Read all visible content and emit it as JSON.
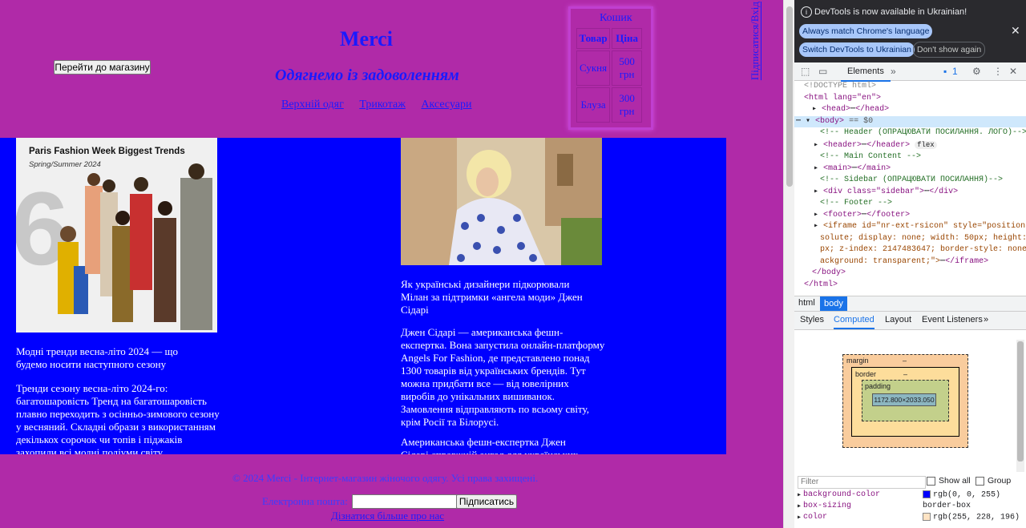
{
  "header": {
    "shop_button": "Перейти до магазину",
    "logo": "Merci",
    "tagline": "Одягнемо із задоволенням",
    "nav": [
      "Верхній одяг",
      "Трикотаж",
      "Аксесуари"
    ],
    "vertical_links": "Підписатися/Вхід"
  },
  "cart": {
    "title": "Кошик",
    "headers": [
      "Товар",
      "Ціна"
    ],
    "rows": [
      {
        "item": "Сукня",
        "price": "500 грн"
      },
      {
        "item": "Блуза",
        "price": "300 грн"
      }
    ]
  },
  "main": {
    "card1": {
      "image_heading": "Paris Fashion Week Biggest Trends",
      "image_subheading": "Spring/Summer 2024",
      "image_number": "6",
      "title": "Модні тренди весна-літо 2024 — що будемо носити наступного сезону",
      "body": "Тренди сезону весна-літо 2024-го: багатошаровість Тренд на багатошаровість плавно переходить з осінньо-зимового сезону у весняний. Складні образи з використанням декількох сорочок чи топів і піджаків захопили всі модні подіуми світу."
    },
    "card2": {
      "title": "Як українські дизайнери підкорювали Мілан за підтримки «ангела моди» Джен Сідарі",
      "body1": "Джен Сідарі — американська фешн-експертка. Вона запустила онлайн-платформу Angels For Fashion, де представлено понад 1300 товарів від українських брендів. Тут можна придбати все — від ювелірних виробів до унікальних вишиванок. Замовлення відправляють по всьому світу, крім Росії та Білорусі.",
      "body2": "Американська фешн-експертка Джен Сідарі справжній ангел для українських"
    }
  },
  "footer": {
    "copyright": "© 2024 Merci - Інтернет-магазин жіночого одягу. Усі права захищені.",
    "email_label": "Електронна пошта:",
    "email_value": "",
    "subscribe": "Підписатись",
    "learn_more": "Дізнатися більше про нас"
  },
  "devtools": {
    "banner": "DevTools is now available in Ukrainian!",
    "btn_match": "Always match Chrome's language",
    "btn_switch": "Switch DevTools to Ukrainian",
    "btn_dont": "Don't show again",
    "tab_elements": "Elements",
    "issues_count": "1",
    "dom": {
      "doctype": "<!DOCTYPE html>",
      "html_open": "<html lang=\"en\">",
      "head": "<head>",
      "head_close": "</head>",
      "body_open": "<body>",
      "body_eq": "== $0",
      "c_header": "<!-- Header (ОПРАЦЮВАТИ ПОСИЛАННЯ. ЛОГО)-->",
      "header": "<header>",
      "header_close": "</header>",
      "flex": "flex",
      "c_main": "<!-- Main Content -->",
      "main": "<main>",
      "main_close": "</main>",
      "c_sidebar": "<!-- Sidebar (ОПРАЦЮВАТИ ПОСИЛАННЯ)-->",
      "div_open": "<div class=\"sidebar\">",
      "div_close": "</div>",
      "c_footer": "<!-- Footer -->",
      "footer": "<footer>",
      "footer_close": "</footer>",
      "iframe1": "<iframe id=\"nr-ext-rsicon\" style=\"position: ab",
      "iframe2": "solute; display: none; width: 50px; height: 50",
      "iframe3": "px; z-index: 2147483647; border-style: none; b",
      "iframe4": "ackground: transparent;\">",
      "iframe_close": "</iframe>",
      "body_close": "</body>",
      "html_close": "</html>",
      "ellipsis": "⋯"
    },
    "crumbs": [
      "html",
      "body"
    ],
    "subtabs": [
      "Styles",
      "Computed",
      "Layout",
      "Event Listeners"
    ],
    "box": {
      "margin": "margin",
      "border": "border",
      "padding": "padding",
      "content": "1172.800×2033.050",
      "dash": "–"
    },
    "filter_placeholder": "Filter",
    "show_all": "Show all",
    "group": "Group",
    "props": [
      {
        "k": "background-color",
        "v": "rgb(0, 0, 255)",
        "c": "#0000ff"
      },
      {
        "k": "box-sizing",
        "v": "border-box",
        "c": ""
      },
      {
        "k": "color",
        "v": "rgb(255, 228, 196)",
        "c": "#ffe4c4"
      }
    ]
  }
}
